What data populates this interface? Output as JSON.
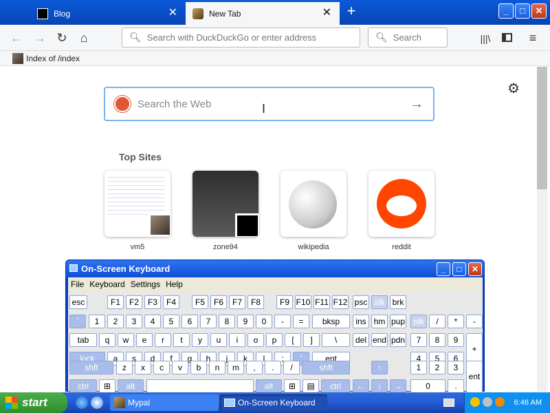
{
  "tabs": [
    {
      "label": "Blog"
    },
    {
      "label": "New Tab"
    }
  ],
  "window": {
    "minimize": "_",
    "maximize": "□",
    "close": "✕",
    "new_tab": "+"
  },
  "nav": {
    "url_placeholder": "Search with DuckDuckGo or enter address",
    "search_placeholder": "Search"
  },
  "bookmarks": [
    {
      "label": "Index of /index"
    }
  ],
  "newtab": {
    "search_placeholder": "Search the Web",
    "top_sites_title": "Top Sites",
    "sites": [
      {
        "label": "vm5"
      },
      {
        "label": "zone94"
      },
      {
        "label": "wikipedia"
      },
      {
        "label": "reddit"
      }
    ]
  },
  "osk": {
    "title": "On-Screen Keyboard",
    "menu": [
      "File",
      "Keyboard",
      "Settings",
      "Help"
    ],
    "keys": {
      "row1": [
        "esc",
        "F1",
        "F2",
        "F3",
        "F4",
        "F5",
        "F6",
        "F7",
        "F8",
        "F9",
        "F10",
        "F11",
        "F12",
        "psc",
        "slk",
        "brk"
      ],
      "row2": [
        "`",
        "1",
        "2",
        "3",
        "4",
        "5",
        "6",
        "7",
        "8",
        "9",
        "0",
        "-",
        "=",
        "bksp",
        "ins",
        "hm",
        "pup",
        "nlk",
        "/",
        "*",
        "-"
      ],
      "row3": [
        "tab",
        "q",
        "w",
        "e",
        "r",
        "t",
        "y",
        "u",
        "i",
        "o",
        "p",
        "[",
        "]",
        "\\",
        "del",
        "end",
        "pdn",
        "7",
        "8",
        "9",
        "+"
      ],
      "row4": [
        "lock",
        "a",
        "s",
        "d",
        "f",
        "g",
        "h",
        "j",
        "k",
        "l",
        ";",
        "'",
        "ent",
        "4",
        "5",
        "6"
      ],
      "row5": [
        "shft",
        "z",
        "x",
        "c",
        "v",
        "b",
        "n",
        "m",
        ",",
        ".",
        "/",
        "shft",
        "↑",
        "1",
        "2",
        "3",
        "ent"
      ],
      "row6": [
        "ctrl",
        "alt",
        "alt",
        "ctrl",
        "←",
        "↓",
        "→",
        "0",
        "."
      ]
    }
  },
  "taskbar": {
    "start": "start",
    "tasks": [
      {
        "label": "Mypal"
      },
      {
        "label": "On-Screen Keyboard"
      }
    ],
    "clock": "6:46 AM"
  }
}
